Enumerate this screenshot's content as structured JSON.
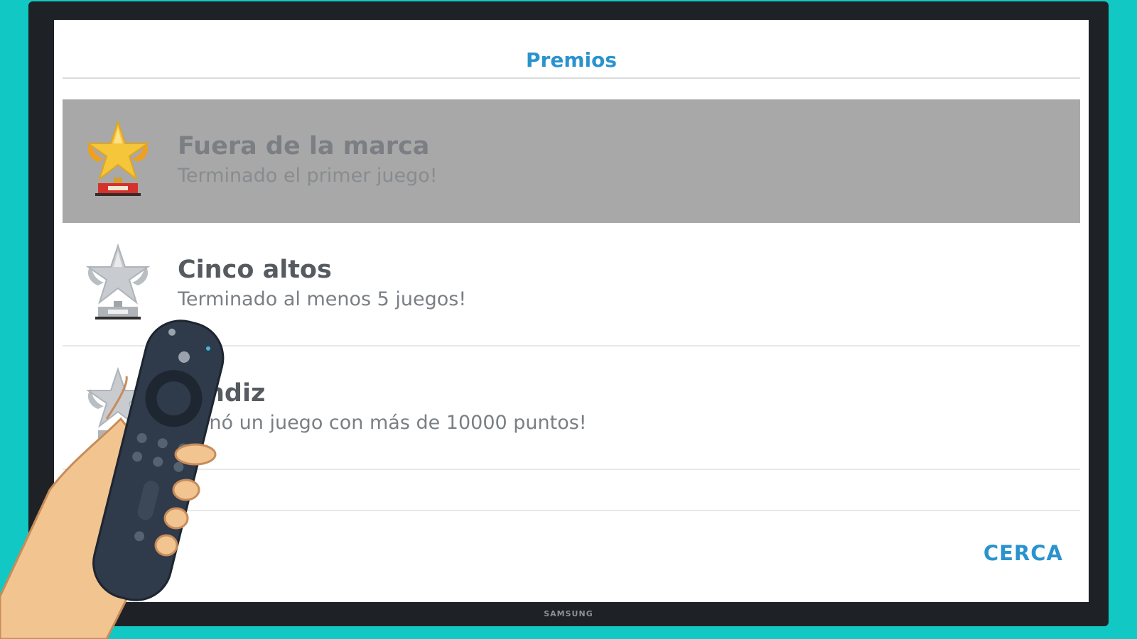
{
  "tv": {
    "brand": "SAMSUNG"
  },
  "dialog": {
    "title": "Premios",
    "close_label": "CERCA"
  },
  "awards": [
    {
      "name": "Fuera de la marca",
      "description": "Terminado el primer juego!",
      "status": "earned",
      "icon": "gold-trophy-icon"
    },
    {
      "name": "Cinco altos",
      "description": "Terminado al menos 5 juegos!",
      "status": "locked",
      "icon": "silver-trophy-icon"
    },
    {
      "name": "rendiz",
      "description": "rminó un juego con más de 10000 puntos!",
      "status": "locked",
      "icon": "silver-trophy-icon"
    }
  ],
  "colors": {
    "background": "#11c8c4",
    "accent": "#2a93cf",
    "selected_row": "#a8a8a8",
    "gold": "#f5c53a",
    "silver": "#c8ccd0"
  }
}
